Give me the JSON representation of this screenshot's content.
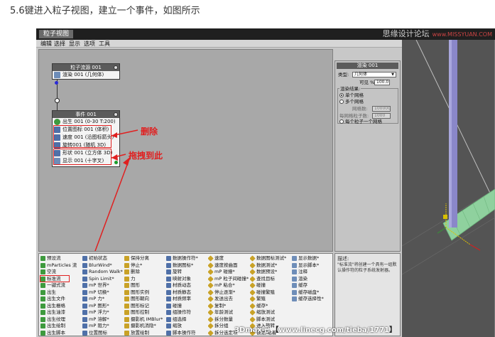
{
  "caption": "5.6键进入粒子视图，建立一个事件，如图所示",
  "window": {
    "title": "粒子视图",
    "brand": "思缘设计论坛",
    "brand_sub": "www.MISSYUAN.COM"
  },
  "menu": [
    "编辑",
    "选择",
    "显示",
    "选项",
    "工具"
  ],
  "source_node": {
    "title": "粒子流源 001",
    "row": "渲染 001 (几何体)"
  },
  "event_node": {
    "title": "事件 001",
    "rows": [
      "出生 001 (0-30 T:200)",
      "位置图标 001 (体积)",
      "速度 001 (沿图标箭头)",
      "旋转001 (随机 3D)",
      "形状 001 (立方体 3D)",
      "显示 001 (十字叉)"
    ]
  },
  "annotations": {
    "delete": "删除",
    "drag": "拖拽到此"
  },
  "depot": {
    "columns": [
      [
        "预设流",
        "mParticles 流",
        "空流",
        "标准流",
        "一键式流",
        "出生",
        "出生文件",
        "出生栅格",
        "出生油漆",
        "出生纹理",
        "出生绘制",
        "出生脚本"
      ],
      [
        "初始状态",
        "BlurWind*",
        "Random Walk*",
        "Spin Limit*",
        "mP 世界*",
        "mP 切换*",
        "mP 力*",
        "mP 图形*",
        "mP 浮力*",
        "mP 溶解*",
        "mP 阻力*",
        "位置图标"
      ],
      [
        "保持分离",
        "停止*",
        "删除",
        "力",
        "图形",
        "图形实例",
        "图形朝向",
        "图形标记",
        "图形控制",
        "摄影机 IMBlur*",
        "摄影机消隐*",
        "放置绘制"
      ],
      [
        "数据操作符*",
        "数据图标*",
        "旋转",
        "映射对象",
        "材质动态",
        "材质静态",
        "材质频率",
        "碰撞",
        "组操作符",
        "组选择",
        "缩放",
        "脚本操作符"
      ],
      [
        "速度",
        "速度按曲面",
        "mP 碰撞*",
        "mP 粒子间碰撞*",
        "mP 粘合*",
        "停止逐渐*",
        "发送出去",
        "复制*",
        "年龄测试",
        "拆分数量",
        "拆分组",
        "拆分选定项"
      ],
      [
        "数据图标测试*",
        "数据测试*",
        "数据预设*",
        "查找目标",
        "碰撞",
        "碰撞繁殖",
        "繁殖",
        "缓存*",
        "缩放测试",
        "脚本测试",
        "进入旋转",
        "锁定/粘着"
      ],
      [
        "显示数据*",
        "显示脚本*",
        "注释",
        "渲染",
        "缓存",
        "缓存磁盘*",
        "缓存选择性*"
      ]
    ]
  },
  "params": {
    "rollout": "渲染 001",
    "type_label": "类型:",
    "type_value": "几何体",
    "visible_label": "可见 %",
    "visible_value": "100.0",
    "group_label": "渲染结果:",
    "opt_single": "单个网格",
    "opt_multi": "多个网格",
    "mesh_count_label": "网格数:",
    "mesh_count_value": "100000",
    "per_mesh_label": "每网格粒子数:",
    "per_mesh_value": "1000",
    "opt_each": "每个粒子一个网格"
  },
  "description": {
    "label": "描述:",
    "text": "\"标准流\"将创建一个具有一组默认操作符的粒子系统发射器。"
  },
  "watermark": {
    "left": "3Dmax吧",
    "url": "www.linecg.com/tieba/1771"
  },
  "colors": {
    "red_annotation": "#e02020",
    "node_header": "#5b5b5b",
    "viewport_bg": "#545454",
    "grid_green": "#8fd19e",
    "pillar_blue": "#8a87c9"
  }
}
